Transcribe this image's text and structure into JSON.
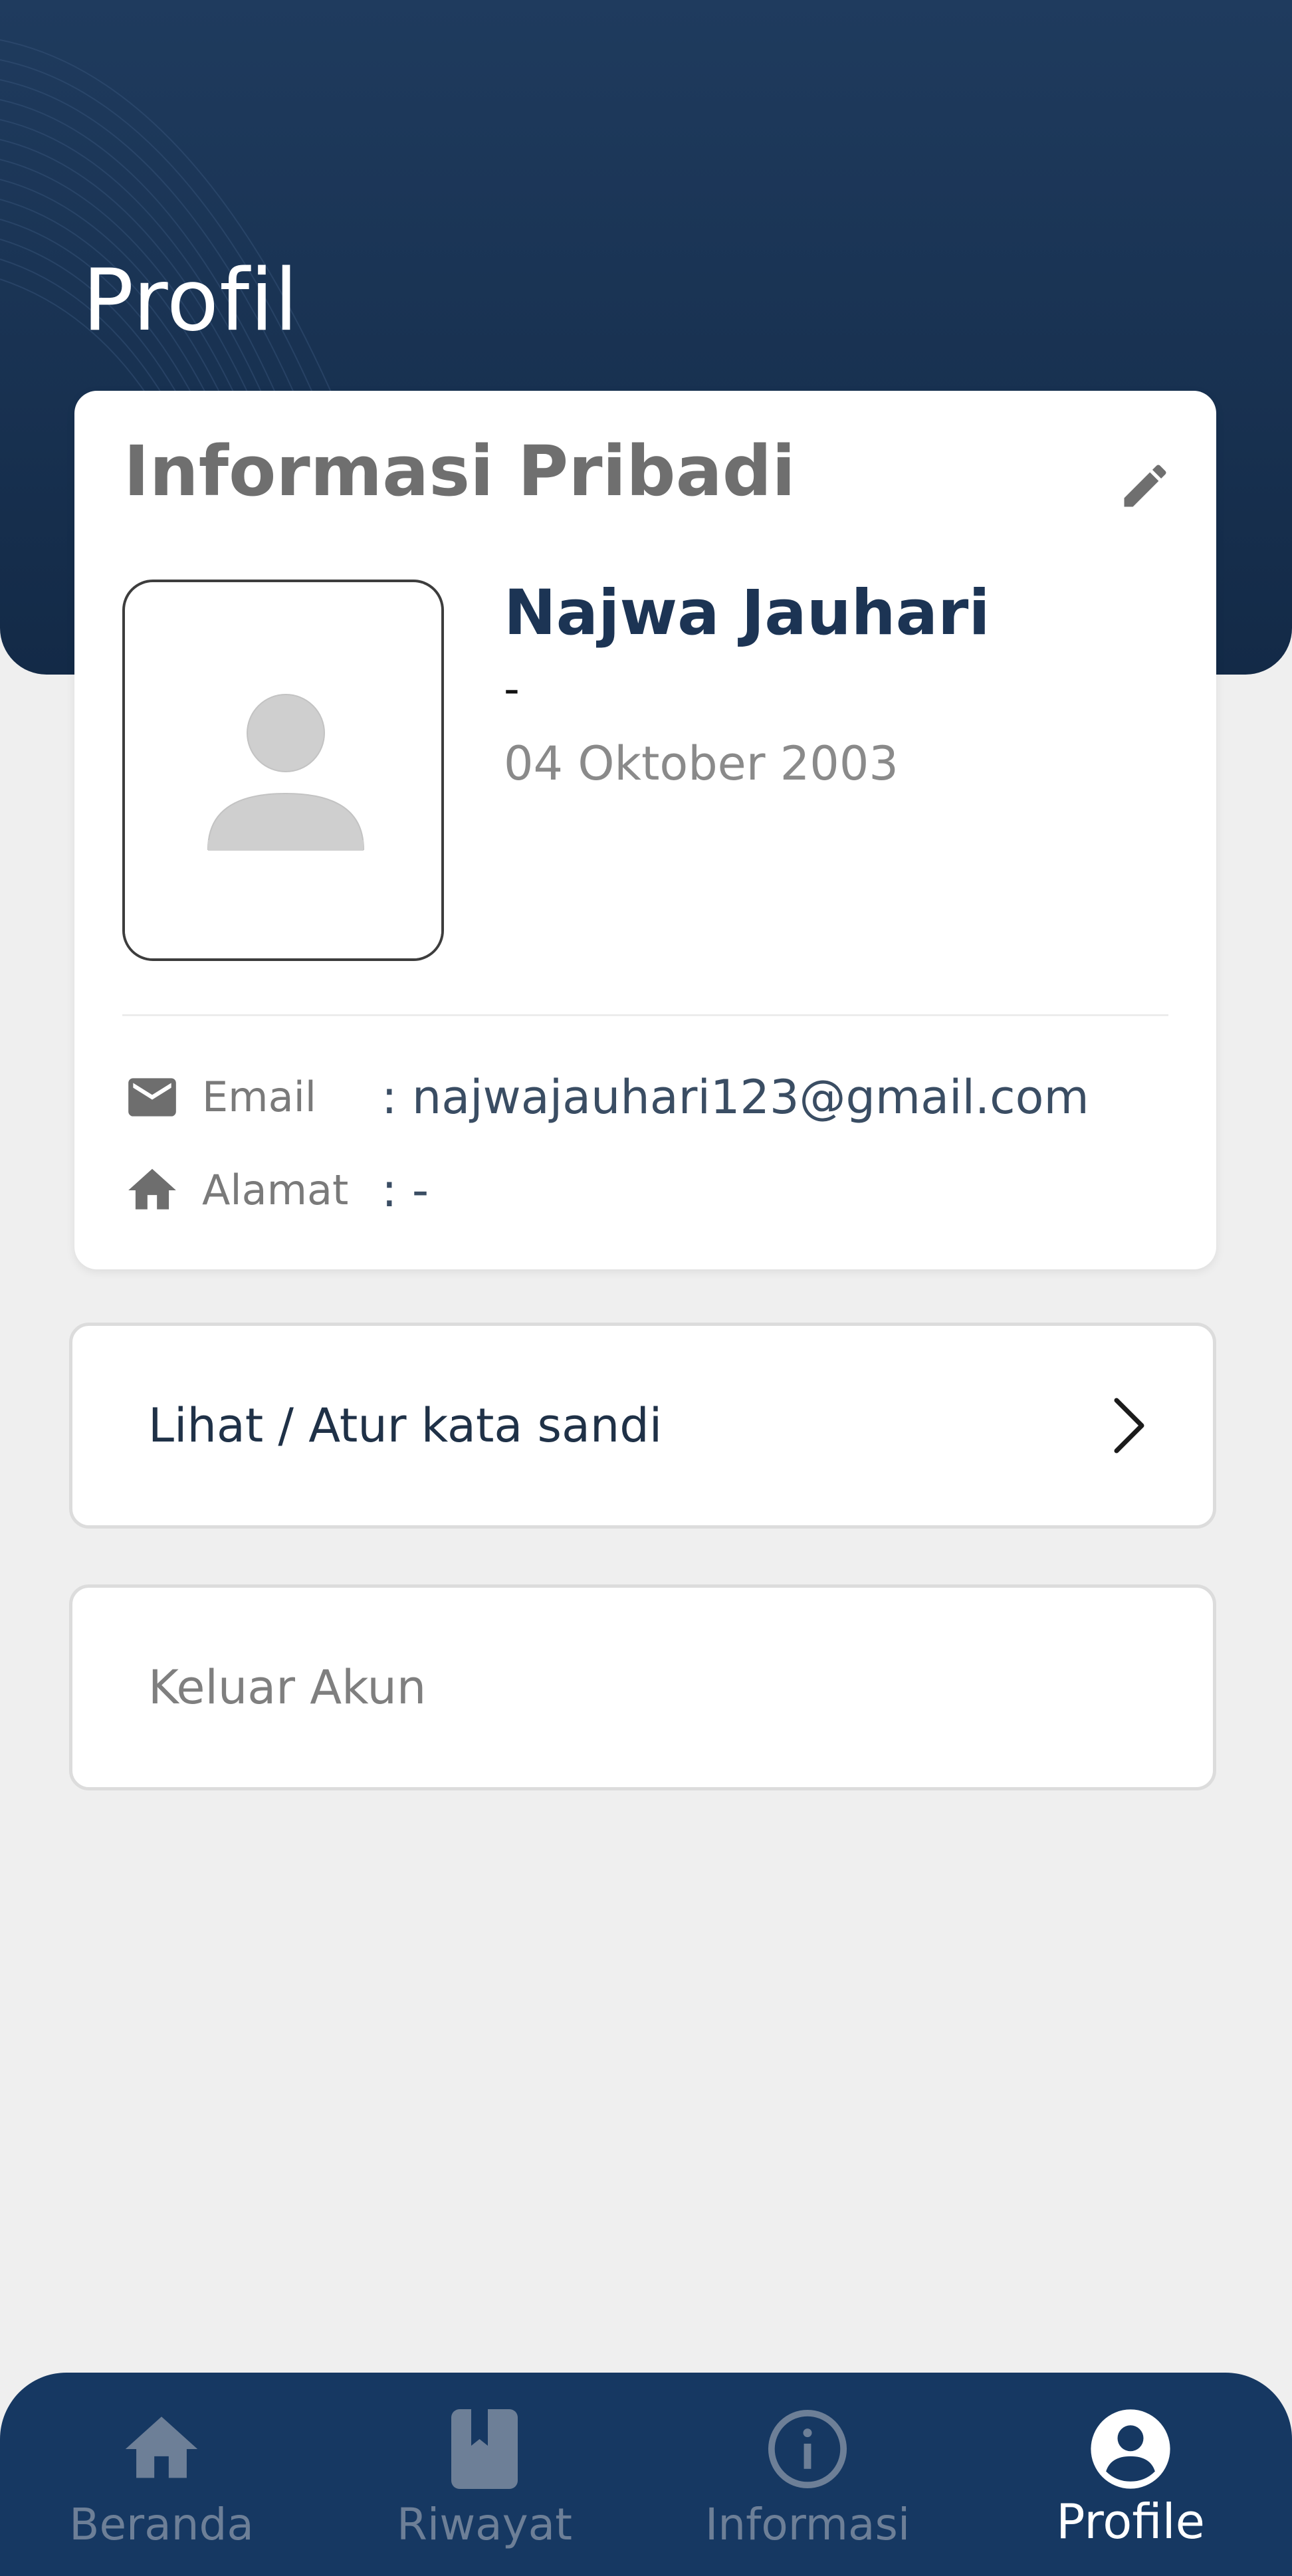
{
  "header": {
    "title": "Profil"
  },
  "info_card": {
    "title": "Informasi Pribadi",
    "edit_icon": "pencil-icon",
    "avatar_icon": "person-placeholder-icon",
    "name": "Najwa Jauhari",
    "subtitle": "-",
    "birth_date": "04 Oktober 2003",
    "details": [
      {
        "icon": "mail-icon",
        "label": "Email",
        "value": ": najwajauhari123@gmail.com"
      },
      {
        "icon": "home-icon",
        "label": "Alamat",
        "value": ": -"
      }
    ]
  },
  "actions": {
    "password_label": "Lihat / Atur kata sandi",
    "logout_label": "Keluar Akun"
  },
  "bottom_nav": {
    "items": [
      {
        "label": "Beranda",
        "icon": "home-icon",
        "active": false
      },
      {
        "label": "Riwayat",
        "icon": "bookmark-book-icon",
        "active": false
      },
      {
        "label": "Informasi",
        "icon": "info-circle-icon",
        "active": false
      },
      {
        "label": "Profile",
        "icon": "account-circle-icon",
        "active": true
      }
    ]
  },
  "colors": {
    "header_bg": "#1f3b5e",
    "nav_bg": "#163862",
    "name_text": "#1c3454",
    "page_bg": "#efefef",
    "inactive_nav": "#6d7f97",
    "active_nav": "#ffffff"
  }
}
